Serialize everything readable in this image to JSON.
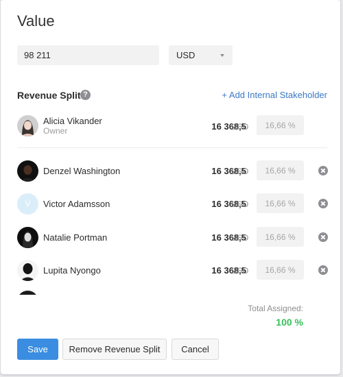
{
  "title": "Value",
  "value_input": {
    "value": "98 211"
  },
  "currency_select": {
    "selected": "USD"
  },
  "section": {
    "title": "Revenue Split",
    "add_link": "+ Add Internal Stakeholder"
  },
  "stakeholders": [
    {
      "name": "Alicia Vikander",
      "role": "Owner",
      "amount": "16 368,5",
      "currency": "USD",
      "percent": "16,66 %",
      "avatar": "photo"
    },
    {
      "name": "Denzel Washington",
      "amount": "16 368,5",
      "currency": "USD",
      "percent": "16,66 %",
      "avatar": "photo"
    },
    {
      "name": "Victor Adamsson",
      "amount": "16 368,5",
      "currency": "USD",
      "percent": "16,66 %",
      "avatar": "V"
    },
    {
      "name": "Natalie Portman",
      "amount": "16 368,5",
      "currency": "USD",
      "percent": "16,66 %",
      "avatar": "photo"
    },
    {
      "name": "Lupita Nyongo",
      "amount": "16 368,5",
      "currency": "USD",
      "percent": "16,66 %",
      "avatar": "photo"
    }
  ],
  "total": {
    "label": "Total Assigned:",
    "value": "100 %"
  },
  "buttons": {
    "save": "Save",
    "remove": "Remove Revenue Split",
    "cancel": "Cancel"
  },
  "colors": {
    "accent": "#3a8de0",
    "link": "#3a78c4",
    "success": "#36c05a"
  },
  "icons": {
    "help": "help-icon",
    "remove": "remove-icon",
    "dropdown": "chevron-down-icon"
  }
}
